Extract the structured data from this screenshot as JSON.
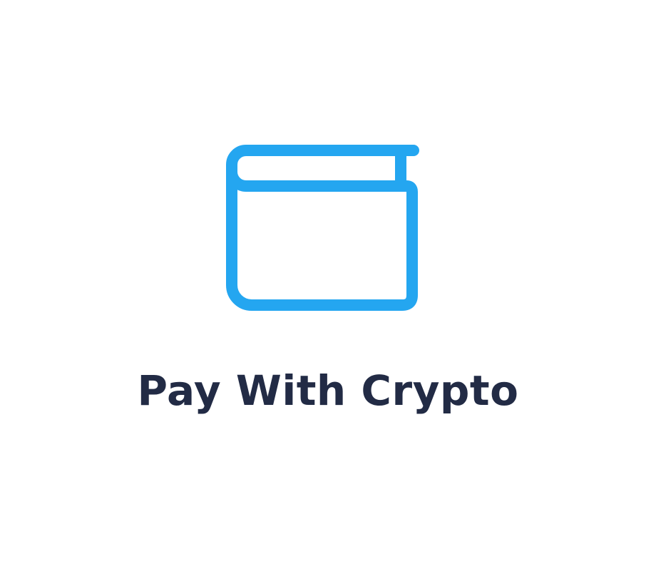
{
  "title": "Pay With Crypto",
  "icon": "wallet-icon",
  "colors": {
    "icon": "#24A6F0",
    "title": "#222B45",
    "background": "#FFFFFF"
  }
}
